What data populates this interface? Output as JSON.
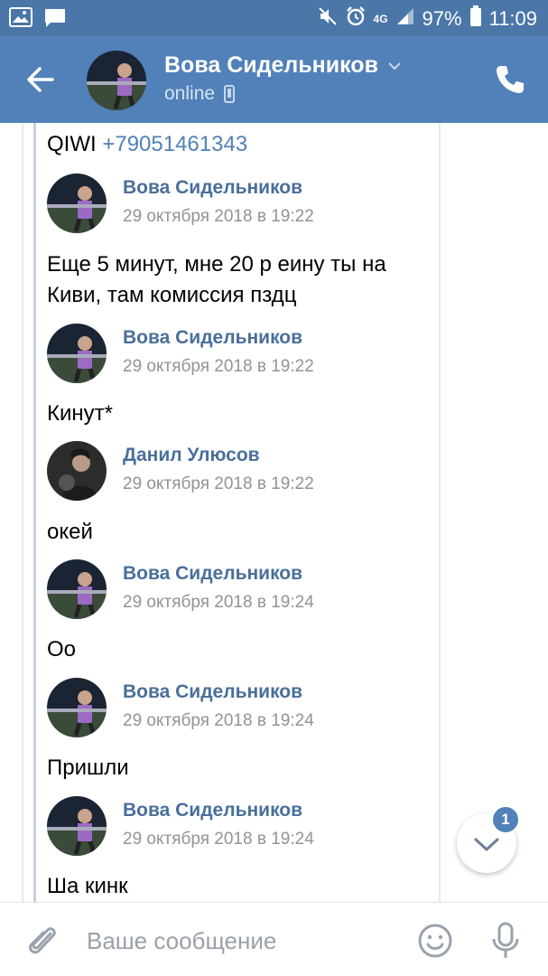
{
  "status_bar": {
    "battery": "97%",
    "time": "11:09",
    "network": "4G"
  },
  "header": {
    "contact_name": "Вова Сидельников",
    "status": "online"
  },
  "chat": {
    "quoted_text": "QIWI",
    "quoted_phone": "+79051461343",
    "messages": [
      {
        "author": "Вова Сидельников",
        "date": "29 октября 2018 в 19:22",
        "text": "Еще 5 минут, мне 20 р еину ты на Киви, там комиссия пздц"
      },
      {
        "author": "Вова Сидельников",
        "date": "29 октября 2018 в 19:22",
        "text": "Кинут*"
      },
      {
        "author": "Данил Улюсов",
        "date": "29 октября 2018 в 19:22",
        "text": "окей"
      },
      {
        "author": "Вова Сидельников",
        "date": "29 октября 2018 в 19:24",
        "text": "Оо"
      },
      {
        "author": "Вова Сидельников",
        "date": "29 октября 2018 в 19:24",
        "text": "Пришли"
      },
      {
        "author": "Вова Сидельников",
        "date": "29 октября 2018 в 19:24",
        "text": "Ша кинк"
      }
    ]
  },
  "scroll_badge": "1",
  "composer": {
    "placeholder": "Ваше сообщение",
    "value": ""
  },
  "colors": {
    "header": "#5181b8",
    "status_bar": "#4a76a8",
    "link": "#5181b8",
    "author": "#4a6f9a"
  }
}
